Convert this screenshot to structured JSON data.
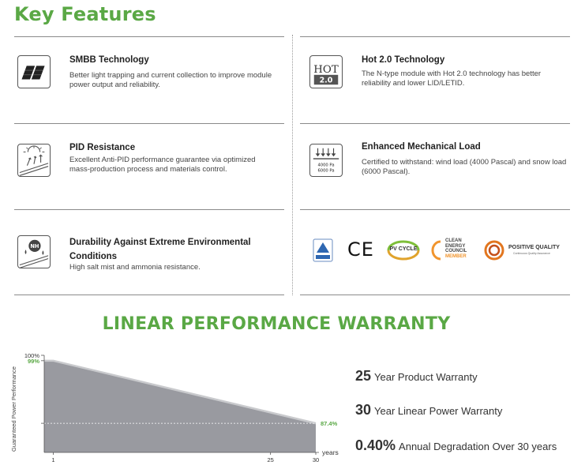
{
  "key_features": {
    "title": "Key Features",
    "items": [
      {
        "title": "SMBB Technology",
        "desc": "Better light trapping and current collection to improve module power output and reliability.",
        "icon": "solar-panel-icon"
      },
      {
        "title": "Hot 2.0 Technology",
        "desc": "The N-type module with  Hot 2.0 technology has better reliability and lower LID/LETID.",
        "icon": "hot-badge-icon",
        "icon_text_top": "HOT",
        "icon_text_bottom": "2.0"
      },
      {
        "title": "PID Resistance",
        "desc": "Excellent Anti-PID performance guarantee via optimized mass-production process and materials control.",
        "icon": "sun-resistance-icon"
      },
      {
        "title": "Enhanced Mechanical Load",
        "desc": "Certified to withstand: wind load (4000 Pascal) and snow load (6000 Pascal).",
        "icon": "mechanical-load-icon",
        "icon_text_1": "4000 Pa",
        "icon_text_2": "6000 Pa"
      },
      {
        "title": "Durability Against Extreme Environmental Conditions",
        "desc": "High salt mist and ammonia resistance.",
        "icon": "ammonia-drops-icon",
        "icon_text": "NH"
      }
    ],
    "certifications": [
      {
        "name": "tuv-certification-logo",
        "label": ""
      },
      {
        "name": "ce-mark-logo",
        "label": "CE"
      },
      {
        "name": "pv-cycle-logo",
        "label": "PV CYCLE"
      },
      {
        "name": "clean-energy-council-logo",
        "label_lines": [
          "CLEAN",
          "ENERGY",
          "COUNCIL",
          "MEMBER"
        ]
      },
      {
        "name": "positive-quality-logo",
        "label": "POSITIVE QUALITY",
        "sublabel": "Continuous Quality Assurance"
      }
    ]
  },
  "warranty": {
    "title": "LINEAR PERFORMANCE WARRANTY",
    "stats": [
      {
        "big": "25",
        "text": "Year Product Warranty"
      },
      {
        "big": "30",
        "text": "Year Linear Power Warranty"
      },
      {
        "big": "0.40%",
        "text": "Annual Degradation Over 30 years"
      }
    ]
  },
  "chart_data": {
    "type": "area",
    "ylabel": "Guaranteed Power Performance",
    "xlabel": "years",
    "x_ticks": [
      "1",
      "25",
      "30"
    ],
    "y_ticks": [
      "100%"
    ],
    "x": [
      0,
      1,
      30
    ],
    "y": [
      99,
      99,
      87.4
    ],
    "xlim": [
      0,
      30
    ],
    "ylim": [
      82,
      100
    ],
    "annotations": [
      "99%",
      "87.4%"
    ],
    "colors": {
      "fill": "#999aa0",
      "accent": "#5aa845"
    }
  }
}
